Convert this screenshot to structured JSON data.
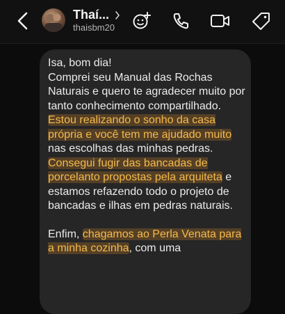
{
  "header": {
    "contact_name": "Thaí...",
    "handle": "thaisbm20",
    "icons": [
      "back-arrow-icon",
      "avatar",
      "chevron-right-icon",
      "add-people-icon",
      "phone-icon",
      "video-icon",
      "tag-icon"
    ]
  },
  "message": {
    "greeting": "Isa, bom dia!",
    "p1": "Comprei seu Manual das Rochas Naturais e quero te agradecer muito por tanto conhecimento compartilhado.",
    "hl1": "Estou realizando o sonho da casa própria e você tem me ajudado muito",
    "p2_rest": " nas escolhas das minhas pedras.",
    "hl2": "Consegui fugir das bancadas de porcelanto propostas pela arquiteta",
    "p3_rest": " e estamos refazendo todo o projeto de bancadas e ilhas em pedras naturais.",
    "p4_start": "Enfim, ",
    "hl3": "chagamos ao Perla Venata para a minha cozinha",
    "p4_rest": ", com uma"
  },
  "colors": {
    "background": "#0c0c0c",
    "bubble": "#262626",
    "highlight_text": "#f5ba4c"
  }
}
